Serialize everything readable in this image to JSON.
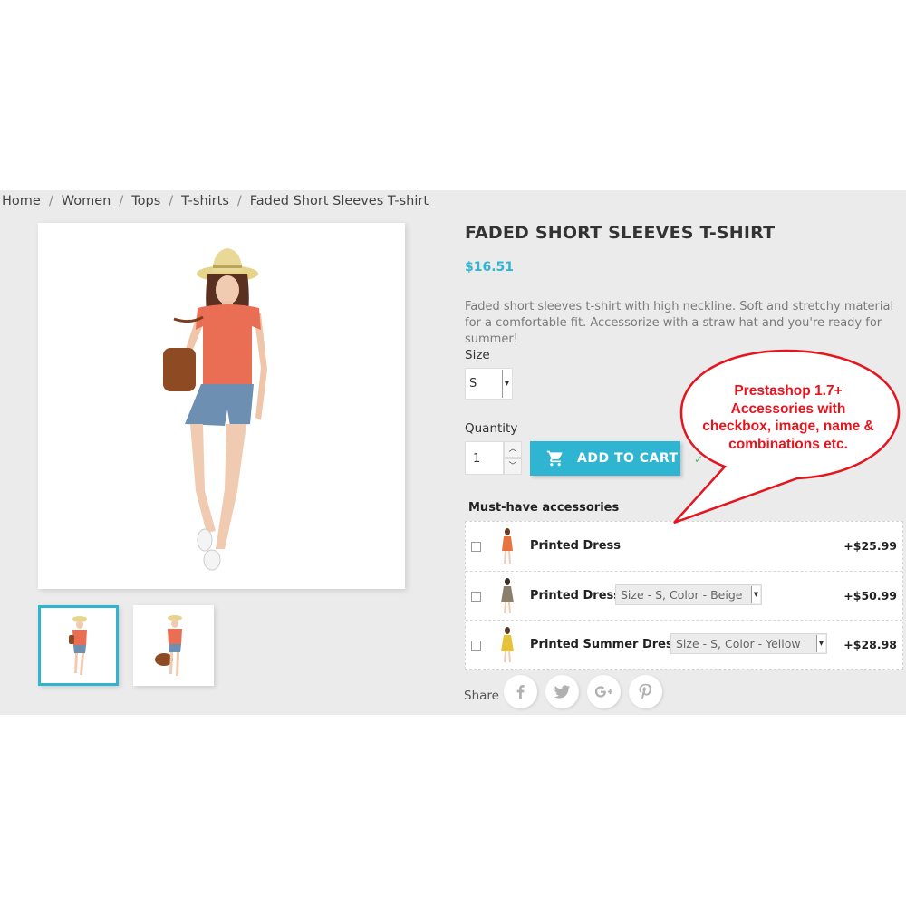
{
  "breadcrumb": {
    "items": [
      "Home",
      "Women",
      "Tops",
      "T-shirts",
      "Faded Short Sleeves T-shirt"
    ],
    "separator": "/"
  },
  "product": {
    "title": "FADED SHORT SLEEVES T-SHIRT",
    "price": "$16.51",
    "description": "Faded short sleeves t-shirt with high neckline. Soft and stretchy material for a comfortable fit. Accessorize with a straw hat and you're ready for summer!",
    "size_label": "Size",
    "size_value": "S",
    "quantity_label": "Quantity",
    "quantity_value": "1",
    "add_to_cart": "ADD TO CART",
    "accent_color": "#2fb5d2"
  },
  "accessories": {
    "title": "Must-have accessories",
    "items": [
      {
        "name": "Printed Dress",
        "combination": "",
        "price": "+$25.99"
      },
      {
        "name": "Printed Dress",
        "combination": "Size - S, Color - Beige",
        "price": "+$50.99"
      },
      {
        "name": "Printed Summer Dress",
        "combination": "Size - S, Color - Yellow",
        "price": "+$28.98"
      }
    ]
  },
  "share": {
    "label": "Share",
    "icons": [
      "facebook-icon",
      "twitter-icon",
      "google-plus-icon",
      "pinterest-icon"
    ]
  },
  "callout": {
    "lines": [
      "Prestashop 1.7+",
      "Accessories with",
      "checkbox, image, name &",
      "combinations etc."
    ],
    "color": "#e5141d"
  }
}
